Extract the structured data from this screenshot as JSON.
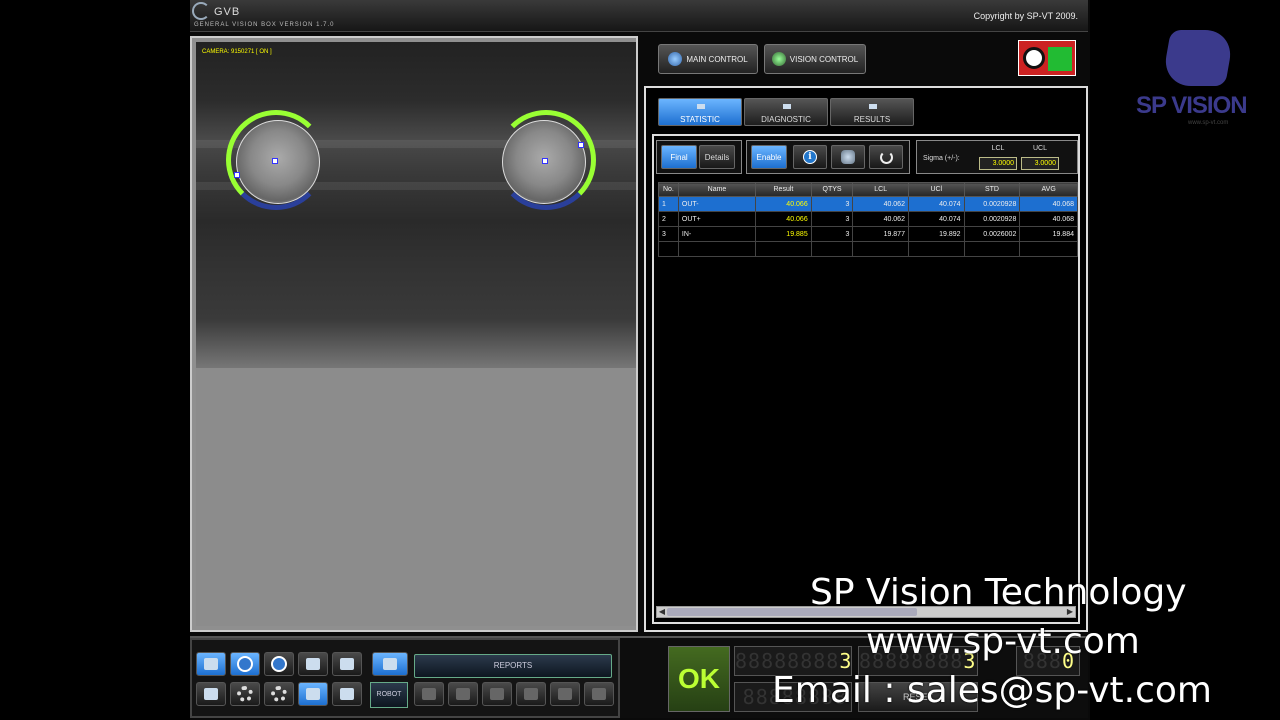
{
  "app": {
    "title": "GVB",
    "subtitle": "GENERAL VISION BOX VERSION 1.7.0",
    "copyright": "Copyright by SP-VT 2009."
  },
  "camera": {
    "label": "CAMERA: 9150271 [ ON ]"
  },
  "header": {
    "main_control": "MAIN CONTROL",
    "vision_control": "VISION CONTROL"
  },
  "tabs": [
    {
      "label": "STATISTIC",
      "active": true
    },
    {
      "label": "DIAGNOSTIC",
      "active": false
    },
    {
      "label": "RESULTS",
      "active": false
    }
  ],
  "toolbar": {
    "final": "Final",
    "details": "Details",
    "enable": "Enable",
    "sigma_label": "Sigma (+/-):",
    "lcl_label": "LCL",
    "ucl_label": "UCL",
    "lcl_value": "3.0000",
    "ucl_value": "3.0000"
  },
  "table": {
    "headers": [
      "No.",
      "Name",
      "Result",
      "QTYS",
      "LCL",
      "UCl",
      "STD",
      "AVG"
    ],
    "rows": [
      {
        "no": "1",
        "name": "OUT-",
        "result": "40.066",
        "qtys": "3",
        "lcl": "40.062",
        "ucl": "40.074",
        "std": "0.0020928",
        "avg": "40.068",
        "selected": true
      },
      {
        "no": "2",
        "name": "OUT+",
        "result": "40.066",
        "qtys": "3",
        "lcl": "40.062",
        "ucl": "40.074",
        "std": "0.0020928",
        "avg": "40.068",
        "selected": false
      },
      {
        "no": "3",
        "name": "IN-",
        "result": "19.885",
        "qtys": "3",
        "lcl": "19.877",
        "ucl": "19.892",
        "std": "0.0026002",
        "avg": "19.884",
        "selected": false
      }
    ]
  },
  "bottom": {
    "reports": "REPORTS",
    "robot": "ROBOT",
    "status": "OK",
    "counter1": "3",
    "counter2": "3",
    "counter3": "0",
    "reset": "RESET"
  },
  "branding": {
    "logo": "SP VISION",
    "logo_url": "www.sp-vt.com",
    "overlay_company": "SP Vision Technology",
    "overlay_web": "www.sp-vt.com",
    "overlay_email": "Email : sales@sp-vt.com"
  },
  "colors": {
    "accent": "#1d6fd0",
    "ok_green": "#bbff33",
    "value_yellow": "#ffff00",
    "ring_green": "#99ff33"
  },
  "icons": [
    "info-icon",
    "database-icon",
    "refresh-icon",
    "gear-icon",
    "stop-icon",
    "play-icon",
    "tools-icon",
    "runner-icon",
    "monitor-icon"
  ]
}
